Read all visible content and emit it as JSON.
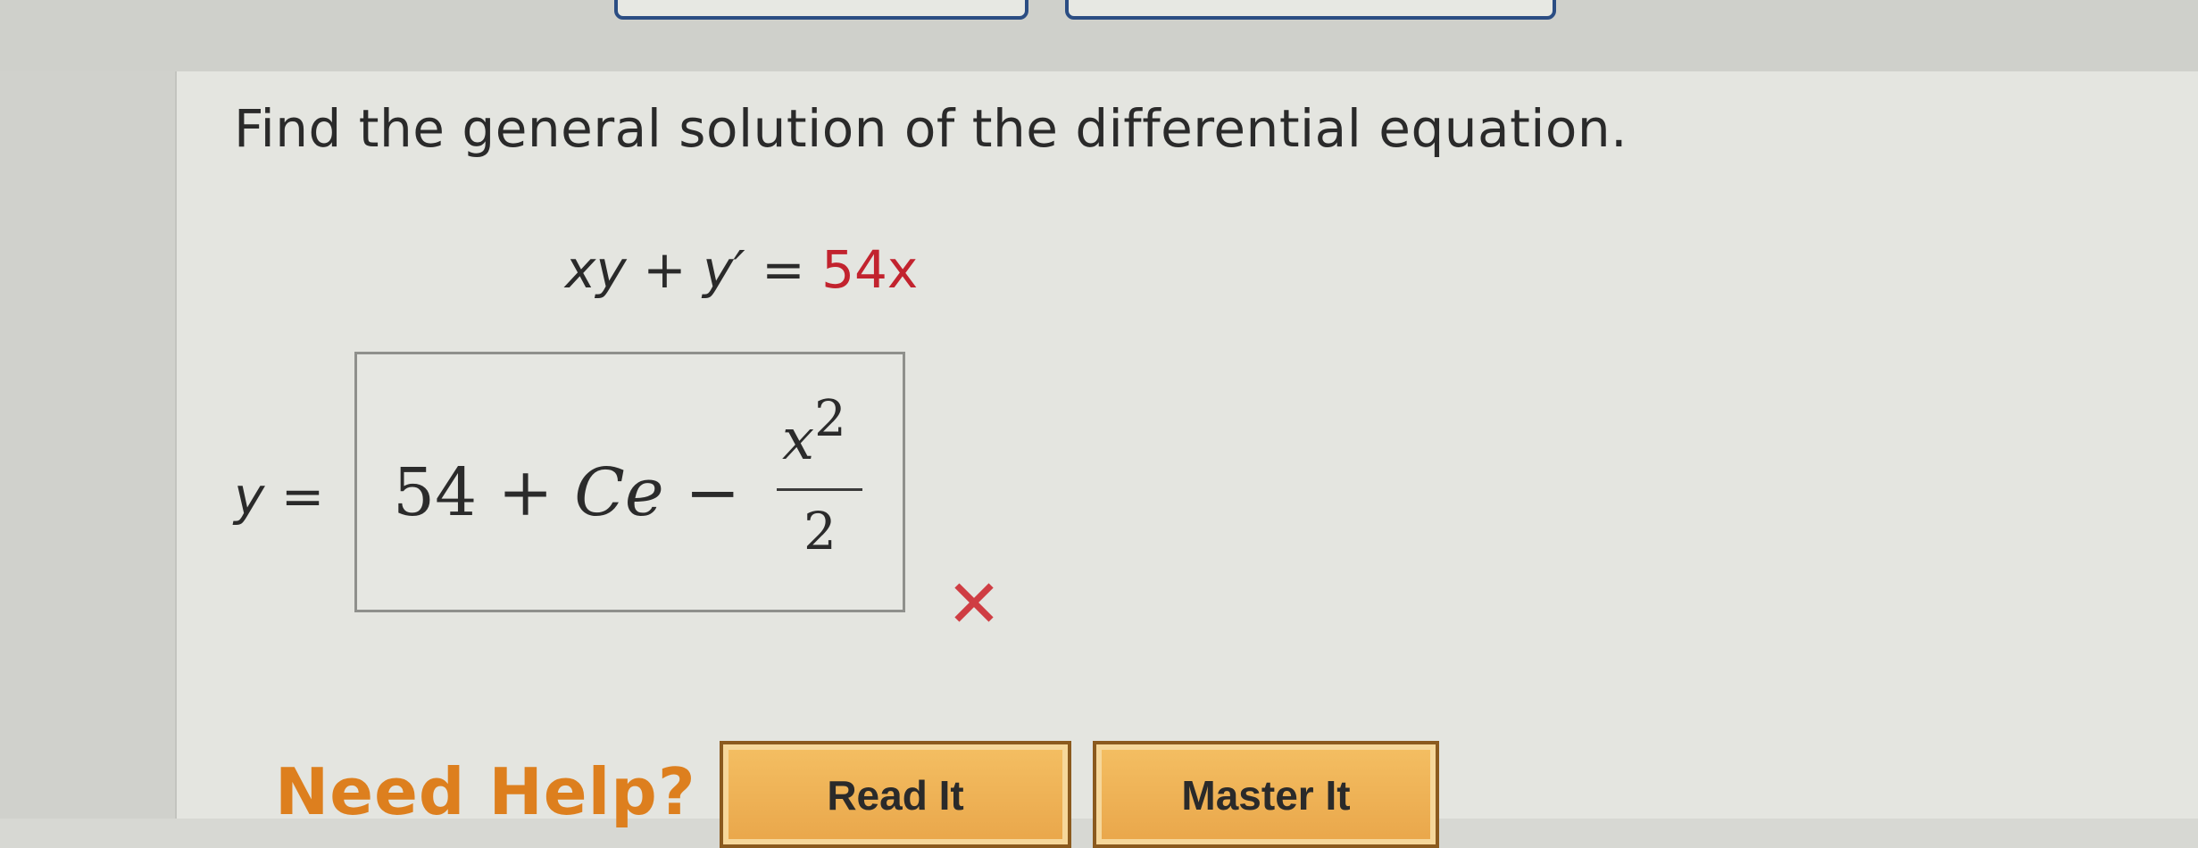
{
  "question": {
    "prompt": "Find the general solution of the differential equation."
  },
  "equation": {
    "lhs_xy": "xy",
    "plus": " + ",
    "y_prime": "y′",
    "equals": " = ",
    "rhs": "54x"
  },
  "answer": {
    "label_y": "y",
    "label_equals": " =",
    "main": "54 + ",
    "ce": "Ce",
    "minus": " − ",
    "exp_var": "x",
    "exp_power": "2",
    "exp_denominator": "2",
    "status": "incorrect",
    "status_icon": "✕"
  },
  "help": {
    "label": "Need Help?",
    "buttons": [
      {
        "label": "Read It"
      },
      {
        "label": "Master It"
      }
    ]
  },
  "colors": {
    "accent_red": "#c2232e",
    "wrong_mark": "#cf3d43",
    "need_help_orange": "#dd7f1e",
    "button_gold": "#f0b65b",
    "top_button_border": "#2b4d83"
  }
}
